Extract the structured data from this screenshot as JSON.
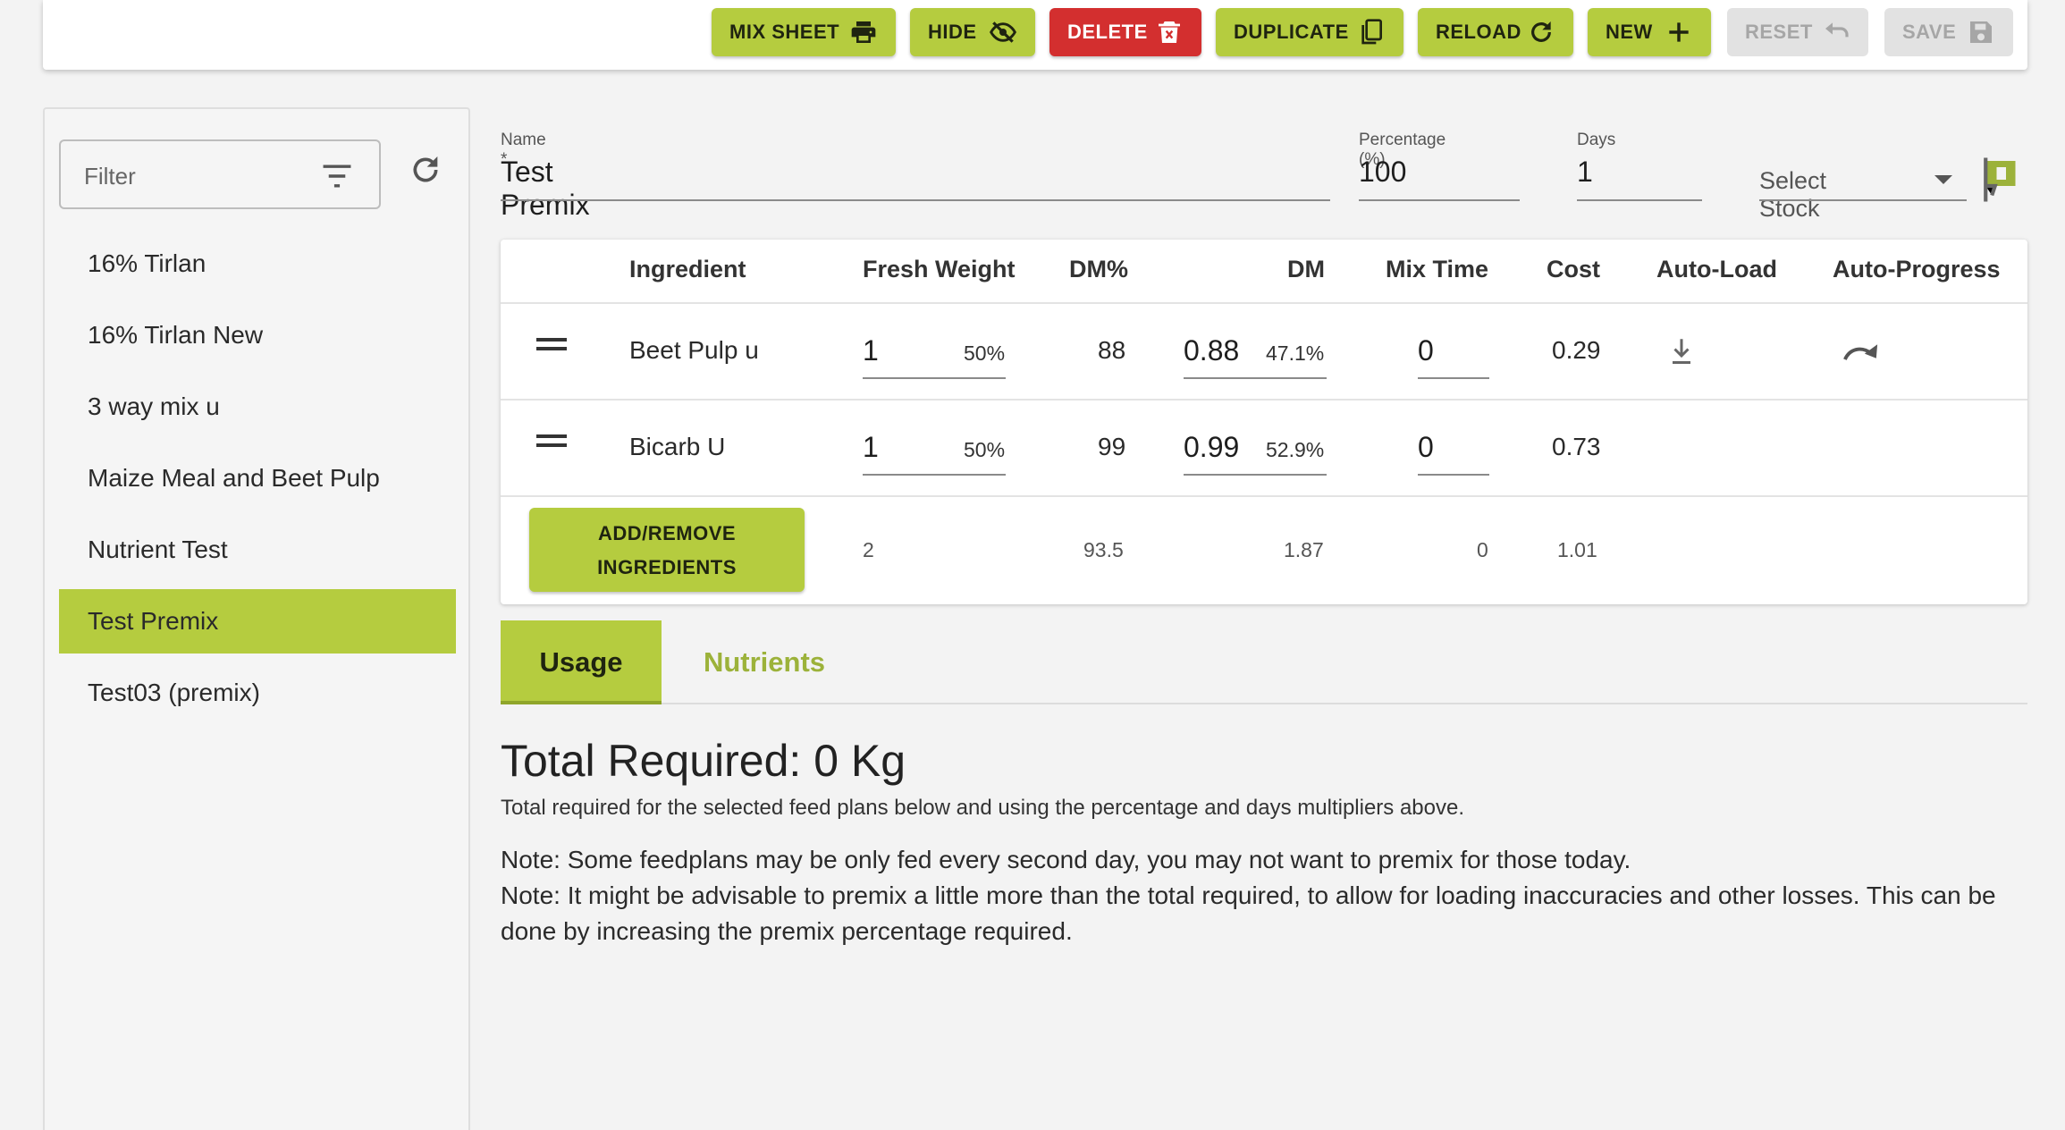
{
  "toolbar": {
    "mix_sheet": "MIX SHEET",
    "hide": "HIDE",
    "delete": "DELETE",
    "duplicate": "DUPLICATE",
    "reload": "RELOAD",
    "new": "NEW",
    "reset": "RESET",
    "save": "SAVE"
  },
  "sidebar": {
    "filter_placeholder": "Filter",
    "items": [
      {
        "label": "16% Tirlan"
      },
      {
        "label": "16% Tirlan New"
      },
      {
        "label": "3 way mix u"
      },
      {
        "label": "Maize Meal and Beet Pulp"
      },
      {
        "label": "Nutrient Test"
      },
      {
        "label": "Test Premix",
        "selected": true
      },
      {
        "label": "Test03 (premix)"
      }
    ]
  },
  "form": {
    "name_label": "Name *",
    "name_value": "Test Premix",
    "percentage_label": "Percentage (%)",
    "percentage_value": "100",
    "days_label": "Days",
    "days_value": "1",
    "stock_placeholder": "Select Stock"
  },
  "table": {
    "headers": {
      "ingredient": "Ingredient",
      "fresh_weight": "Fresh Weight",
      "dm_pct": "DM%",
      "dm": "DM",
      "mix_time": "Mix Time",
      "cost": "Cost",
      "auto_load": "Auto-Load",
      "auto_progress": "Auto-Progress"
    },
    "rows": [
      {
        "ingredient": "Beet Pulp u",
        "fresh_weight": "1",
        "fresh_pct": "50%",
        "dm_pct": "88",
        "dm": "0.88",
        "dm_share": "47.1%",
        "mix_time": "0",
        "cost": "0.29",
        "auto_load_icon": "download-icon",
        "auto_progress_icon": "redo-arrow-icon"
      },
      {
        "ingredient": "Bicarb U",
        "fresh_weight": "1",
        "fresh_pct": "50%",
        "dm_pct": "99",
        "dm": "0.99",
        "dm_share": "52.9%",
        "mix_time": "0",
        "cost": "0.73"
      }
    ],
    "totals": {
      "fresh_weight": "2",
      "dm_pct": "93.5",
      "dm": "1.87",
      "mix_time": "0",
      "cost": "1.01"
    },
    "add_remove_line1": "ADD/REMOVE",
    "add_remove_line2": "INGREDIENTS"
  },
  "tabs": {
    "usage": "Usage",
    "nutrients": "Nutrients",
    "active": "usage"
  },
  "usage": {
    "total_heading": "Total Required: 0 Kg",
    "total_sub": "Total required for the selected feed plans below and using the percentage and days multipliers above.",
    "note1": "Note: Some feedplans may be only fed every second day, you may not want to premix for those today.",
    "note2": "Note: It might be advisable to premix a little more than the total required, to allow for loading inaccuracies and other losses. This can be done by increasing the premix percentage required."
  },
  "colors": {
    "accent": "#b5cc3f",
    "danger": "#d32f2f",
    "disabled": "#e2e2e2"
  }
}
